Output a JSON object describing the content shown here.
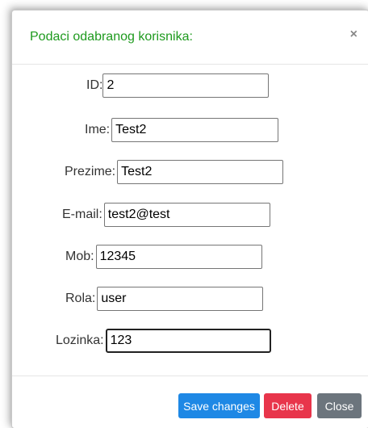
{
  "modal": {
    "title": "Podaci odabranog korisnika:",
    "close_symbol": "×"
  },
  "form": {
    "fields": [
      {
        "label": "ID:",
        "value": "2"
      },
      {
        "label": "Ime:",
        "value": "Test2"
      },
      {
        "label": "Prezime:",
        "value": "Test2"
      },
      {
        "label": "E-mail:",
        "value": "test2@test"
      },
      {
        "label": "Mob:",
        "value": "12345"
      },
      {
        "label": "Rola:",
        "value": "user"
      },
      {
        "label": "Lozinka:",
        "value": "123"
      }
    ]
  },
  "footer": {
    "save_label": "Save changes",
    "delete_label": "Delete",
    "close_label": "Close"
  },
  "colors": {
    "title": "#1e9a1e",
    "save": "#1e88e5",
    "delete": "#e8354b",
    "close": "#6c757d"
  }
}
